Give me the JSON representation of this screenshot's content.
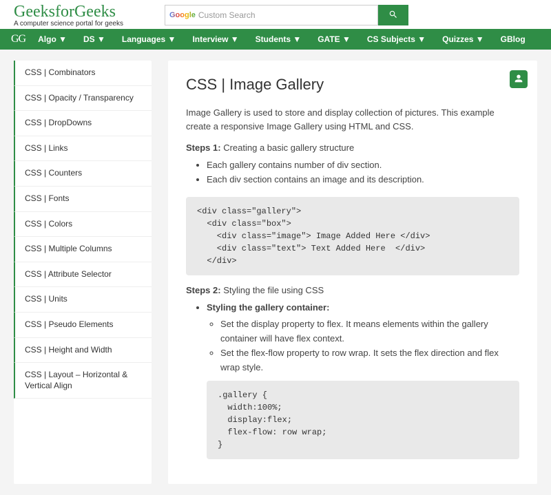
{
  "brand": {
    "title": "GeeksforGeeks",
    "subtitle": "A computer science portal for geeks"
  },
  "search": {
    "google_label": "Google",
    "placeholder": "Custom Search"
  },
  "nav": {
    "logo": "GG",
    "items": [
      "Algo ▼",
      "DS ▼",
      "Languages ▼",
      "Interview ▼",
      "Students ▼",
      "GATE ▼",
      "CS Subjects ▼",
      "Quizzes ▼",
      "GBlog"
    ]
  },
  "sidebar": {
    "items": [
      "CSS | Combinators",
      "CSS | Opacity / Transparency",
      "CSS | DropDowns",
      "CSS | Links",
      "CSS | Counters",
      "CSS | Fonts",
      "CSS | Colors",
      "CSS | Multiple Columns",
      "CSS | Attribute Selector",
      "CSS | Units",
      "CSS | Pseudo Elements",
      "CSS | Height and Width",
      "CSS | Layout – Horizontal & Vertical Align"
    ]
  },
  "article": {
    "title": "CSS | Image Gallery",
    "intro": "Image Gallery is used to store and display collection of pictures. This example create a responsive Image Gallery using HTML and CSS.",
    "step1_label": "Steps 1:",
    "step1_text": " Creating a basic gallery structure",
    "step1_bullets": [
      "Each gallery contains number of div section.",
      "Each div section contains an image and its description."
    ],
    "code1": "<div class=\"gallery\">\n  <div class=\"box\">\n    <div class=\"image\"> Image Added Here </div>\n    <div class=\"text\"> Text Added Here  </div>\n  </div>",
    "step2_label": "Steps 2:",
    "step2_text": " Styling the file using CSS",
    "step2_heading": "Styling the gallery container:",
    "step2_sub": [
      "Set the display property to flex. It means elements within the gallery container will have flex context.",
      "Set the flex-flow property to row wrap. It sets the flex direction and flex wrap style."
    ],
    "code2": ".gallery {\n  width:100%;\n  display:flex;\n  flex-flow: row wrap;\n}"
  }
}
